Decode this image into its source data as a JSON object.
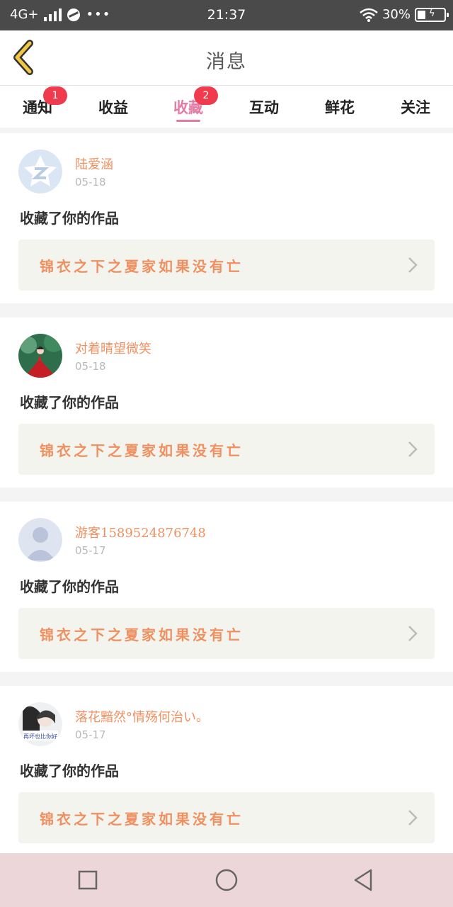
{
  "status_bar": {
    "network": "4G+",
    "time": "21:37",
    "battery": "30%"
  },
  "header": {
    "title": "消息"
  },
  "tabs": [
    {
      "label": "通知",
      "badge": "1",
      "active": false
    },
    {
      "label": "收益",
      "badge": "",
      "active": false
    },
    {
      "label": "收藏",
      "badge": "2",
      "active": true
    },
    {
      "label": "互动",
      "badge": "",
      "active": false
    },
    {
      "label": "鲜花",
      "badge": "",
      "active": false
    },
    {
      "label": "关注",
      "badge": "",
      "active": false
    }
  ],
  "messages": [
    {
      "username": "陆爱涵",
      "date": "05-18",
      "action": "收藏了你的作品",
      "work_title": "锦衣之下之夏家如果没有亡",
      "avatar": "qzone-default-avatar"
    },
    {
      "username": "对着晴望微笑",
      "date": "05-18",
      "action": "收藏了你的作品",
      "work_title": "锦衣之下之夏家如果没有亡",
      "avatar": "photo-avatar-red-dress"
    },
    {
      "username": "游客1589524876748",
      "date": "05-17",
      "action": "收藏了你的作品",
      "work_title": "锦衣之下之夏家如果没有亡",
      "avatar": "default-person-avatar"
    },
    {
      "username": "落花黯然°情殇何治い。",
      "date": "05-17",
      "action": "收藏了你的作品",
      "work_title": "锦衣之下之夏家如果没有亡",
      "avatar": "photo-avatar-girl",
      "avatar_caption": "再坏也比你好"
    }
  ],
  "colors": {
    "accent": "#e47aa3",
    "badge": "#f03a4e",
    "username": "#f09060",
    "back_arrow": "#f2c744",
    "nav_bar": "#ecd6d9"
  }
}
